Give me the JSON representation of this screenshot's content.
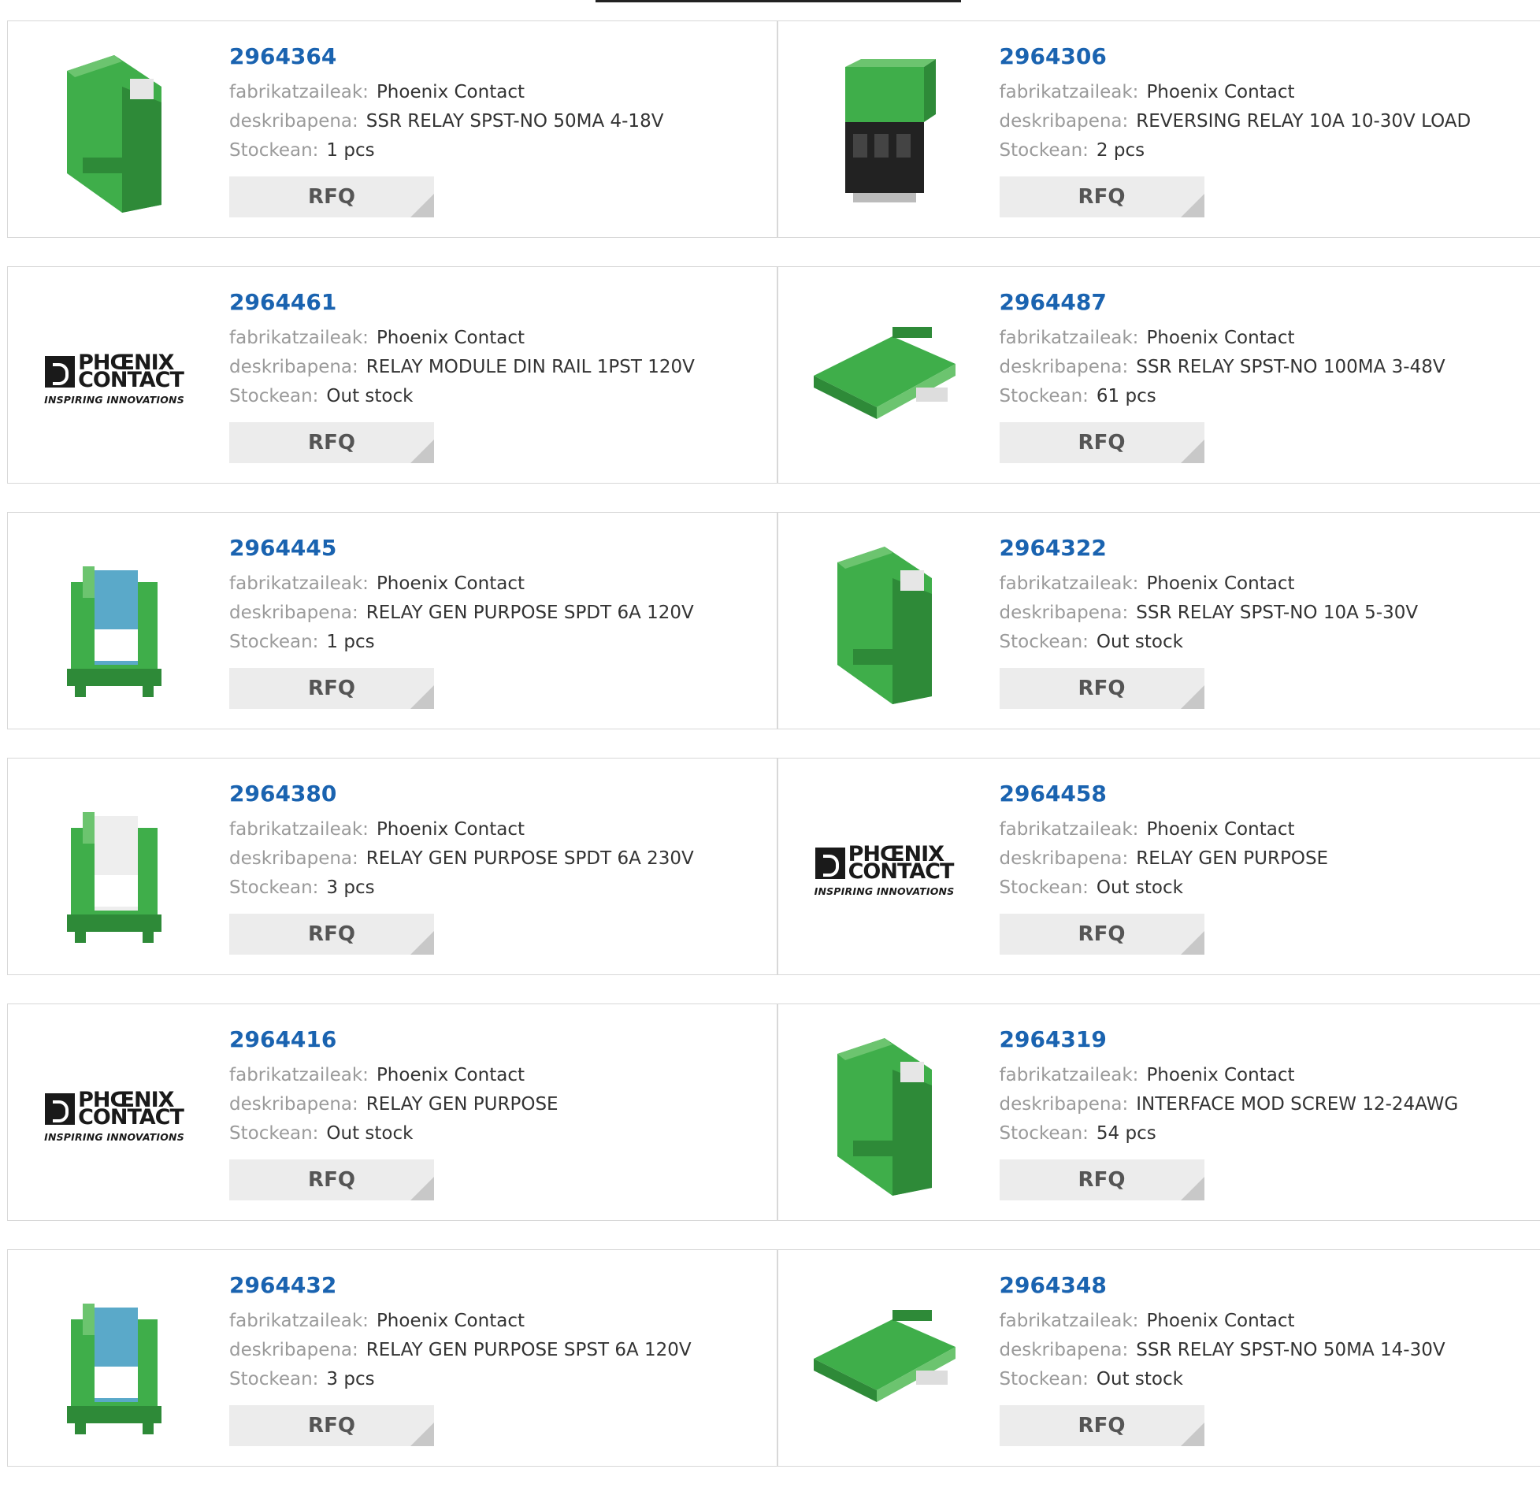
{
  "labels": {
    "manufacturer": "fabrikatzaileak:",
    "description": "deskribapena:",
    "stock": "Stockean:",
    "rfq": "RFQ"
  },
  "logo": {
    "line1": "PHŒNIX",
    "line2": "CONTACT",
    "tagline": "INSPIRING INNOVATIONS"
  },
  "products": [
    {
      "pn": "2964364",
      "manufacturer": "Phoenix Contact",
      "description": "SSR RELAY SPST-NO 50MA 4-18V",
      "stock": "1 pcs",
      "image": "relay-slim"
    },
    {
      "pn": "2964306",
      "manufacturer": "Phoenix Contact",
      "description": "REVERSING RELAY 10A 10-30V LOAD",
      "stock": "2 pcs",
      "image": "relay-block"
    },
    {
      "pn": "2964461",
      "manufacturer": "Phoenix Contact",
      "description": "RELAY MODULE DIN RAIL 1PST 120V",
      "stock": "Out stock",
      "image": "phoenix-logo"
    },
    {
      "pn": "2964487",
      "manufacturer": "Phoenix Contact",
      "description": "SSR RELAY SPST-NO 100MA 3-48V",
      "stock": "61 pcs",
      "image": "relay-flat"
    },
    {
      "pn": "2964445",
      "manufacturer": "Phoenix Contact",
      "description": "RELAY GEN PURPOSE SPDT 6A 120V",
      "stock": "1 pcs",
      "image": "relay-blue"
    },
    {
      "pn": "2964322",
      "manufacturer": "Phoenix Contact",
      "description": "SSR RELAY SPST-NO 10A 5-30V",
      "stock": "Out stock",
      "image": "relay-slim"
    },
    {
      "pn": "2964380",
      "manufacturer": "Phoenix Contact",
      "description": "RELAY GEN PURPOSE SPDT 6A 230V",
      "stock": "3 pcs",
      "image": "relay-white"
    },
    {
      "pn": "2964458",
      "manufacturer": "Phoenix Contact",
      "description": "RELAY GEN PURPOSE",
      "stock": "Out stock",
      "image": "phoenix-logo"
    },
    {
      "pn": "2964416",
      "manufacturer": "Phoenix Contact",
      "description": "RELAY GEN PURPOSE",
      "stock": "Out stock",
      "image": "phoenix-logo"
    },
    {
      "pn": "2964319",
      "manufacturer": "Phoenix Contact",
      "description": "INTERFACE MOD SCREW 12-24AWG",
      "stock": "54 pcs",
      "image": "relay-slim"
    },
    {
      "pn": "2964432",
      "manufacturer": "Phoenix Contact",
      "description": "RELAY GEN PURPOSE SPST 6A 120V",
      "stock": "3 pcs",
      "image": "relay-blue"
    },
    {
      "pn": "2964348",
      "manufacturer": "Phoenix Contact",
      "description": "SSR RELAY SPST-NO 50MA 14-30V",
      "stock": "Out stock",
      "image": "relay-flat"
    }
  ],
  "colors": {
    "link": "#1a63b0",
    "relay_green": "#3fae4a",
    "relay_blue": "#5aa9c9"
  }
}
